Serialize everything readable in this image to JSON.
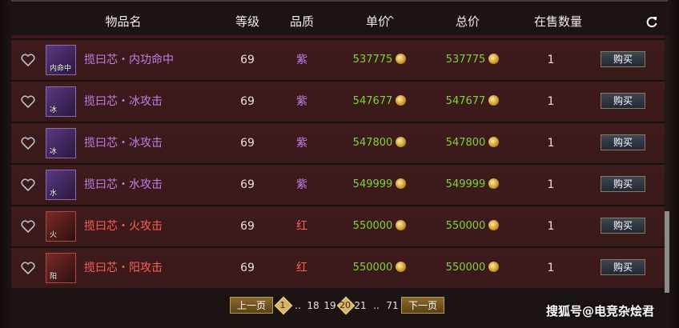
{
  "header": {
    "col_name": "物品名",
    "col_level": "等级",
    "col_quality": "品质",
    "col_unit_price": "单价",
    "col_sort_arrow": "^",
    "col_total_price": "总价",
    "col_quantity": "在售数量"
  },
  "rows": [
    {
      "name": "揽曰芯・内功命中",
      "icon_text": "内命中",
      "level": "69",
      "quality": "紫",
      "unit_price": "537775",
      "total_price": "537775",
      "qty": "1",
      "buy": "购买"
    },
    {
      "name": "揽曰芯・冰攻击",
      "icon_text": "冰",
      "level": "69",
      "quality": "紫",
      "unit_price": "547677",
      "total_price": "547677",
      "qty": "1",
      "buy": "购买"
    },
    {
      "name": "揽曰芯・冰攻击",
      "icon_text": "冰",
      "level": "69",
      "quality": "紫",
      "unit_price": "547800",
      "total_price": "547800",
      "qty": "1",
      "buy": "购买"
    },
    {
      "name": "揽曰芯・水攻击",
      "icon_text": "水",
      "level": "69",
      "quality": "紫",
      "unit_price": "549999",
      "total_price": "549999",
      "qty": "1",
      "buy": "购买"
    },
    {
      "name": "揽曰芯・火攻击",
      "icon_text": "火",
      "level": "69",
      "quality": "红",
      "unit_price": "550000",
      "total_price": "550000",
      "qty": "1",
      "buy": "购买"
    },
    {
      "name": "揽曰芯・阳攻击",
      "icon_text": "阳",
      "level": "69",
      "quality": "红",
      "unit_price": "550000",
      "total_price": "550000",
      "qty": "1",
      "buy": "购买"
    }
  ],
  "pager": {
    "prev": "上一页",
    "first": "1",
    "ellipsis1": "..",
    "p18": "18",
    "p19": "19",
    "current": "20",
    "p21": "21",
    "ellipsis2": "..",
    "last": "71",
    "next": "下一页"
  },
  "watermark": "搜狐号@电竞杂烩君",
  "colors": {
    "purple_text": "#c27fe6",
    "red_text": "#ff5f55",
    "price_green": "#7ed23c",
    "row_bg": "#3e1b1d"
  }
}
